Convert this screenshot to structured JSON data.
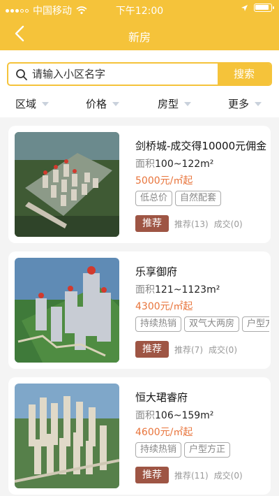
{
  "status": {
    "carrier": "中国移动",
    "time": "下午12:00"
  },
  "nav": {
    "title": "新房"
  },
  "search": {
    "placeholder": "请输入小区名字",
    "button": "搜索"
  },
  "filters": [
    "区域",
    "价格",
    "房型",
    "更多"
  ],
  "listings": [
    {
      "name": "剑桥城-成交得10000元佣金",
      "area_label": "面积",
      "area": "100~122m²",
      "price": "5000元/㎡起",
      "tags": [
        "低总价",
        "自然配套"
      ],
      "badge": "推荐",
      "recommend": "推荐(13)",
      "deals": "成交(0)"
    },
    {
      "name": "乐享御府",
      "area_label": "面积",
      "area": "121~1123m²",
      "price": "4300元/㎡起",
      "tags": [
        "持续热销",
        "双气大两房",
        "户型方正"
      ],
      "badge": "推荐",
      "recommend": "推荐(7)",
      "deals": "成交(0)"
    },
    {
      "name": "恒大珺睿府",
      "area_label": "面积",
      "area": "106~159m²",
      "price": "4600元/㎡起",
      "tags": [
        "持续热销",
        "户型方正"
      ],
      "badge": "推荐",
      "recommend": "推荐(11)",
      "deals": "成交(0)"
    }
  ]
}
